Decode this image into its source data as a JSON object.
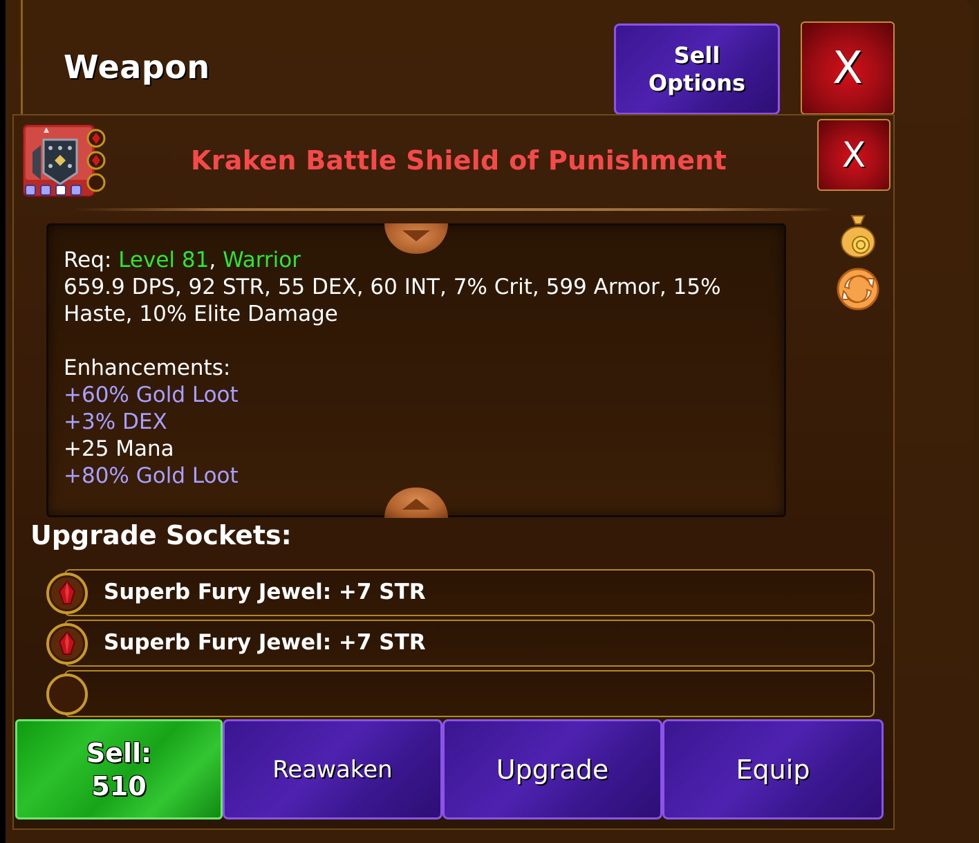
{
  "window": {
    "title": "Weapon",
    "sell_options_label": "Sell\nOptions",
    "close_label": "X"
  },
  "item": {
    "name": "Kraken Battle Shield of Punishment",
    "close_label": "X",
    "req_prefix": "Req: ",
    "req_level": "Level 81",
    "req_sep": ", ",
    "req_class": "Warrior",
    "stats_line1": "659.9 DPS, 92 STR, 55 DEX, 60 INT, 7% Crit, 599 Armor, 15%",
    "stats_line2": "Haste, 10% Elite Damage",
    "enhancements_title": "Enhancements:",
    "enhancements": [
      {
        "text": "+60% Gold Loot",
        "color": "#a7a0ff"
      },
      {
        "text": "+3% DEX",
        "color": "#a7a0ff"
      },
      {
        "text": "+25 Mana",
        "color": "#ffffff"
      },
      {
        "text": "+80% Gold Loot",
        "color": "#a7a0ff"
      }
    ]
  },
  "sockets": {
    "title": "Upgrade Sockets:",
    "rows": [
      {
        "text": "Superb Fury Jewel: +7 STR",
        "filled": true
      },
      {
        "text": "Superb Fury Jewel: +7 STR",
        "filled": true
      },
      {
        "text": "",
        "filled": false
      }
    ]
  },
  "actions": {
    "sell_label": "Sell:",
    "sell_value": "510",
    "reawaken": "Reawaken",
    "upgrade": "Upgrade",
    "equip": "Equip"
  },
  "icons": {
    "item": "shield-icon",
    "gold_bag": "gold-bag-icon",
    "swap": "swap-arrows-icon",
    "gem": "red-gem-icon"
  },
  "colors": {
    "item_name": "#f44a4a",
    "requirement": "#2fe62f",
    "enhancement": "#a7a0ff",
    "button_purple": "#4e22b0",
    "button_green": "#2bc12b",
    "button_red": "#c2121a"
  }
}
